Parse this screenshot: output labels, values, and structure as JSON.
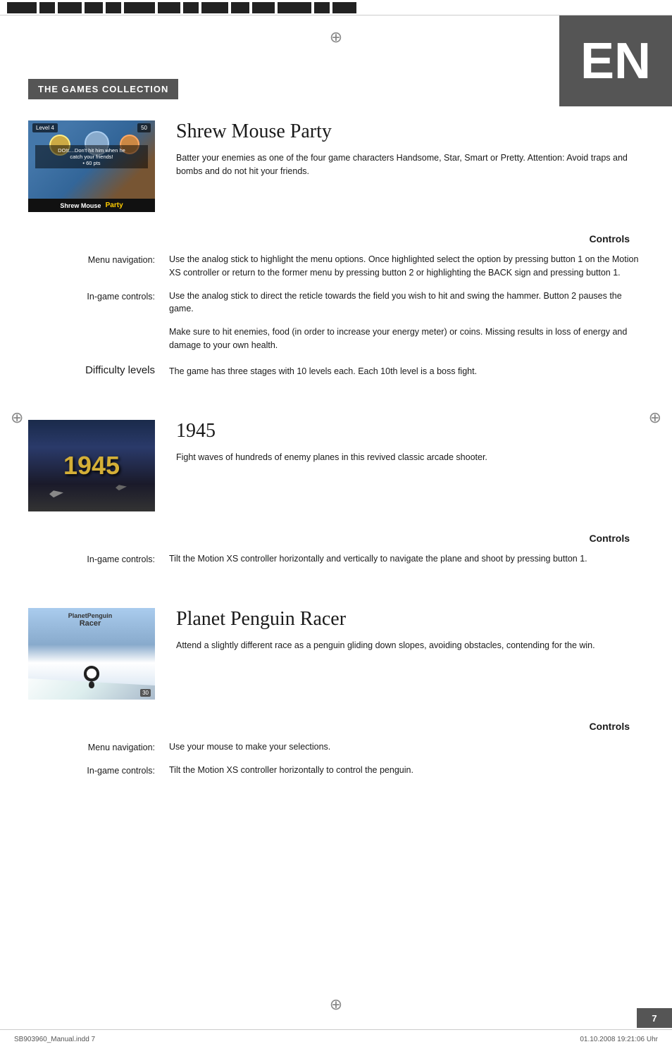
{
  "topbar": {
    "segments": [
      40,
      20,
      30,
      25,
      20,
      40,
      30,
      20,
      35,
      25,
      30,
      45,
      20,
      30
    ]
  },
  "header": {
    "collection_label": "THE GAMES COLLECTION",
    "language_label": "EN"
  },
  "game1": {
    "title": "Shrew Mouse Party",
    "image_label_line1": "Shrew Mouse",
    "image_label_line2": "Party",
    "description": "Batter your enemies as one of the four game characters Handsome, Star, Smart or Pretty. Attention: Avoid traps and bombs and do not hit your friends.",
    "controls_heading": "Controls",
    "controls": [
      {
        "label": "Menu navigation:",
        "value": "Use the analog stick to highlight the menu options. Once highlighted select the option by pressing button 1 on the Motion XS controller or return to the former menu by pressing button 2 or highlighting the BACK sign and pressing button 1."
      },
      {
        "label": "In-game controls:",
        "value": "Use the analog stick to direct the reticle towards the field you wish to hit and swing the hammer. Button 2 pauses the game."
      },
      {
        "label": "",
        "value": "Make sure to hit enemies, food (in order to increase your energy meter) or coins. Missing results in loss of energy and damage to your own health."
      }
    ],
    "difficulty_label": "Difficulty levels",
    "difficulty_text": "The game has three stages with 10 levels each. Each 10th level is a boss fight."
  },
  "game2": {
    "title": "1945",
    "description": "Fight waves of hundreds of enemy planes in this revived classic arcade shooter.",
    "controls_heading": "Controls",
    "controls": [
      {
        "label": "In-game controls:",
        "value": "Tilt the Motion XS controller horizontally and vertically to navigate the plane and shoot by pressing button 1."
      }
    ]
  },
  "game3": {
    "title": "Planet Penguin Racer",
    "image_label_line1": "PlanetPenguin",
    "image_label_line2": "Racer",
    "description": "Attend a slightly different race as a penguin gliding down slopes, avoiding obstacles, contending for the win.",
    "controls_heading": "Controls",
    "controls": [
      {
        "label": "Menu navigation:",
        "value": "Use your mouse to make your selections."
      },
      {
        "label": "In-game controls:",
        "value": "Tilt the Motion XS controller horizontally to control the penguin."
      }
    ]
  },
  "footer": {
    "left": "SB903960_Manual.indd   7",
    "right": "01.10.2008   19:21:06 Uhr",
    "page": "7"
  }
}
